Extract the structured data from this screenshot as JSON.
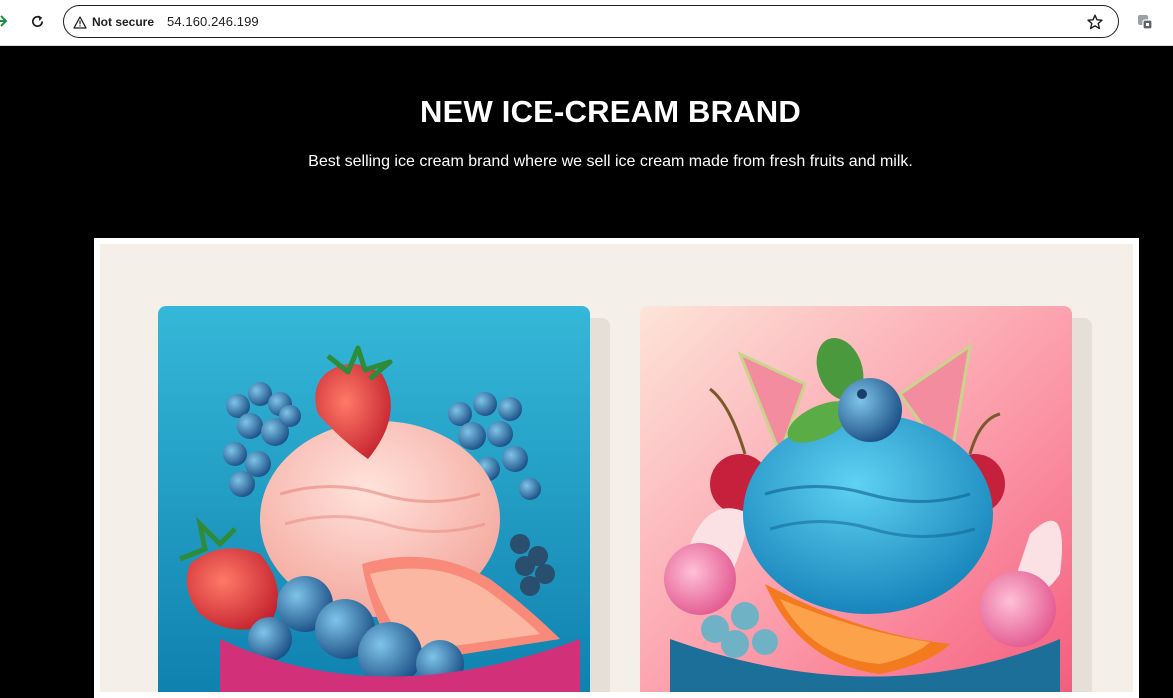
{
  "browser": {
    "security_label": "Not secure",
    "url": "54.160.246.199",
    "icons": {
      "forward": "forward-arrow-icon",
      "reload": "reload-icon",
      "warning": "warning-triangle-icon",
      "bookmark": "bookmark-star-icon",
      "extension": "extension-icon"
    }
  },
  "hero": {
    "title": "NEW ICE-CREAM BRAND",
    "subtitle": "Best selling ice cream brand where we sell ice cream made from fresh fruits and milk."
  },
  "banner": {
    "cards": [
      {
        "name": "strawberry-blueberry-grapefruit-sundae",
        "bg": "#1aa3c7"
      },
      {
        "name": "blue-scoop-berry-orange-sundae",
        "bg": "#f66f89"
      }
    ]
  },
  "colors": {
    "page_bg": "#000000",
    "text": "#ffffff",
    "frame": "#ffffff",
    "banner_bg": "#f4efe9"
  }
}
